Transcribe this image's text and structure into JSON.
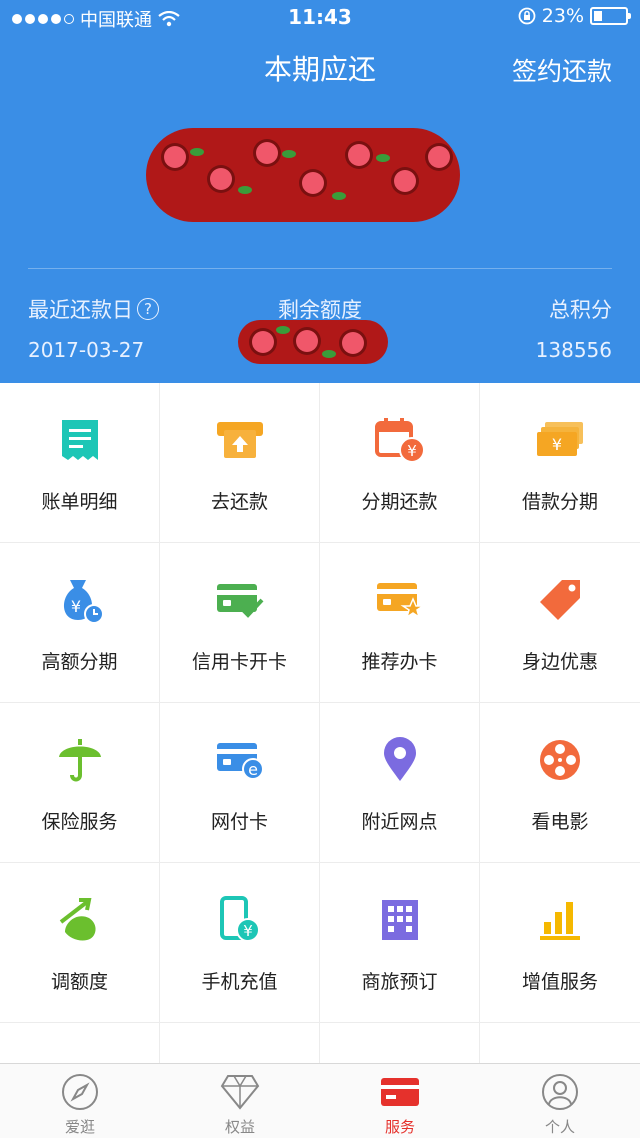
{
  "status_bar": {
    "carrier": "中国联通",
    "time": "11:43",
    "battery": "23%",
    "battery_level": 0.23
  },
  "header": {
    "title": "本期应还",
    "right_action": "签约还款"
  },
  "summary": {
    "left_label": "最近还款日",
    "left_value": "2017-03-27",
    "mid_label": "剩余额度",
    "right_label": "总积分",
    "right_value": "138556"
  },
  "services": [
    {
      "label": "账单明细",
      "icon": "bill-detail-icon",
      "color": "#1dc6b6"
    },
    {
      "label": "去还款",
      "icon": "repay-icon",
      "color": "#f5a623"
    },
    {
      "label": "分期还款",
      "icon": "installment-calendar-icon",
      "color": "#f26a3c"
    },
    {
      "label": "借款分期",
      "icon": "loan-cash-icon",
      "color": "#f5a623"
    },
    {
      "label": "高额分期",
      "icon": "money-bag-icon",
      "color": "#3a8ee6"
    },
    {
      "label": "信用卡开卡",
      "icon": "card-activate-icon",
      "color": "#4caf50"
    },
    {
      "label": "推荐办卡",
      "icon": "recommend-card-icon",
      "color": "#f5a623"
    },
    {
      "label": "身边优惠",
      "icon": "tag-icon",
      "color": "#f26a3c"
    },
    {
      "label": "保险服务",
      "icon": "umbrella-icon",
      "color": "#6bbf2e"
    },
    {
      "label": "网付卡",
      "icon": "e-card-icon",
      "color": "#3a8ee6"
    },
    {
      "label": "附近网点",
      "icon": "location-pin-icon",
      "color": "#7b6be0"
    },
    {
      "label": "看电影",
      "icon": "film-reel-icon",
      "color": "#f26a3c"
    },
    {
      "label": "调额度",
      "icon": "adjust-limit-icon",
      "color": "#6bbf2e"
    },
    {
      "label": "手机充值",
      "icon": "phone-recharge-icon",
      "color": "#1dc6b6"
    },
    {
      "label": "商旅预订",
      "icon": "building-icon",
      "color": "#7b6be0"
    },
    {
      "label": "增值服务",
      "icon": "bar-chart-icon",
      "color": "#f5b800"
    }
  ],
  "tabs": [
    {
      "label": "爱逛",
      "icon": "compass-icon",
      "active": false
    },
    {
      "label": "权益",
      "icon": "diamond-icon",
      "active": false
    },
    {
      "label": "服务",
      "icon": "card-tab-icon",
      "active": true
    },
    {
      "label": "个人",
      "icon": "person-icon",
      "active": false
    }
  ]
}
